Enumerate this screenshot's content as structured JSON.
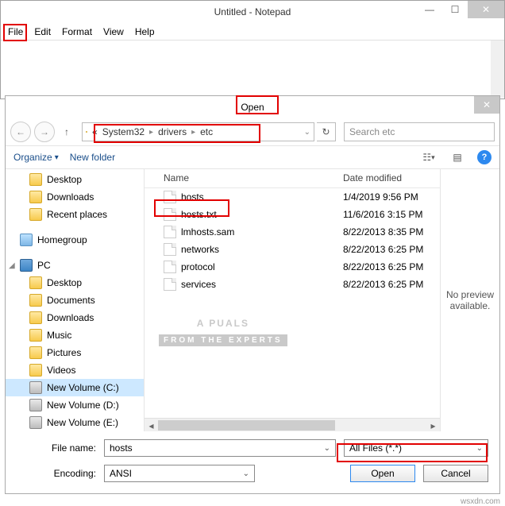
{
  "notepad": {
    "title": "Untitled - Notepad",
    "menu": [
      "File",
      "Edit",
      "Format",
      "View",
      "Help"
    ]
  },
  "open_dialog": {
    "title": "Open",
    "breadcrumb": [
      "«",
      "System32",
      "drivers",
      "etc"
    ],
    "search_placeholder": "Search etc",
    "toolbar": {
      "organize": "Organize",
      "new_folder": "New folder"
    },
    "tree": {
      "items": [
        {
          "label": "Desktop",
          "icon": "folder",
          "lvl": 1
        },
        {
          "label": "Downloads",
          "icon": "folder",
          "lvl": 1
        },
        {
          "label": "Recent places",
          "icon": "folder",
          "lvl": 1
        },
        {
          "spacer": true
        },
        {
          "label": "Homegroup",
          "icon": "hg",
          "lvl": 0
        },
        {
          "spacer": true
        },
        {
          "label": "PC",
          "icon": "pc",
          "lvl": 0,
          "chev": true
        },
        {
          "label": "Desktop",
          "icon": "folder",
          "lvl": 1
        },
        {
          "label": "Documents",
          "icon": "folder",
          "lvl": 1
        },
        {
          "label": "Downloads",
          "icon": "folder",
          "lvl": 1
        },
        {
          "label": "Music",
          "icon": "folder",
          "lvl": 1
        },
        {
          "label": "Pictures",
          "icon": "folder",
          "lvl": 1
        },
        {
          "label": "Videos",
          "icon": "folder",
          "lvl": 1
        },
        {
          "label": "New Volume (C:)",
          "icon": "drive",
          "lvl": 1,
          "sel": true
        },
        {
          "label": "New Volume (D:)",
          "icon": "drive",
          "lvl": 1
        },
        {
          "label": "New Volume (E:)",
          "icon": "drive",
          "lvl": 1
        }
      ]
    },
    "columns": {
      "name": "Name",
      "date": "Date modified"
    },
    "files": [
      {
        "name": "hosts",
        "date": "1/4/2019 9:56 PM"
      },
      {
        "name": "hosts.txt",
        "date": "11/6/2016 3:15 PM"
      },
      {
        "name": "lmhosts.sam",
        "date": "8/22/2013 8:35 PM"
      },
      {
        "name": "networks",
        "date": "8/22/2013 6:25 PM"
      },
      {
        "name": "protocol",
        "date": "8/22/2013 6:25 PM"
      },
      {
        "name": "services",
        "date": "8/22/2013 6:25 PM"
      }
    ],
    "preview_text": "No preview available.",
    "file_name_label": "File name:",
    "file_name_value": "hosts",
    "filter_value": "All Files  (*.*)",
    "encoding_label": "Encoding:",
    "encoding_value": "ANSI",
    "open_btn": "Open",
    "cancel_btn": "Cancel"
  },
  "watermark": {
    "main": "A   PUALS",
    "sub": "FROM  THE  EXPERTS"
  },
  "footer": "wsxdn.com"
}
